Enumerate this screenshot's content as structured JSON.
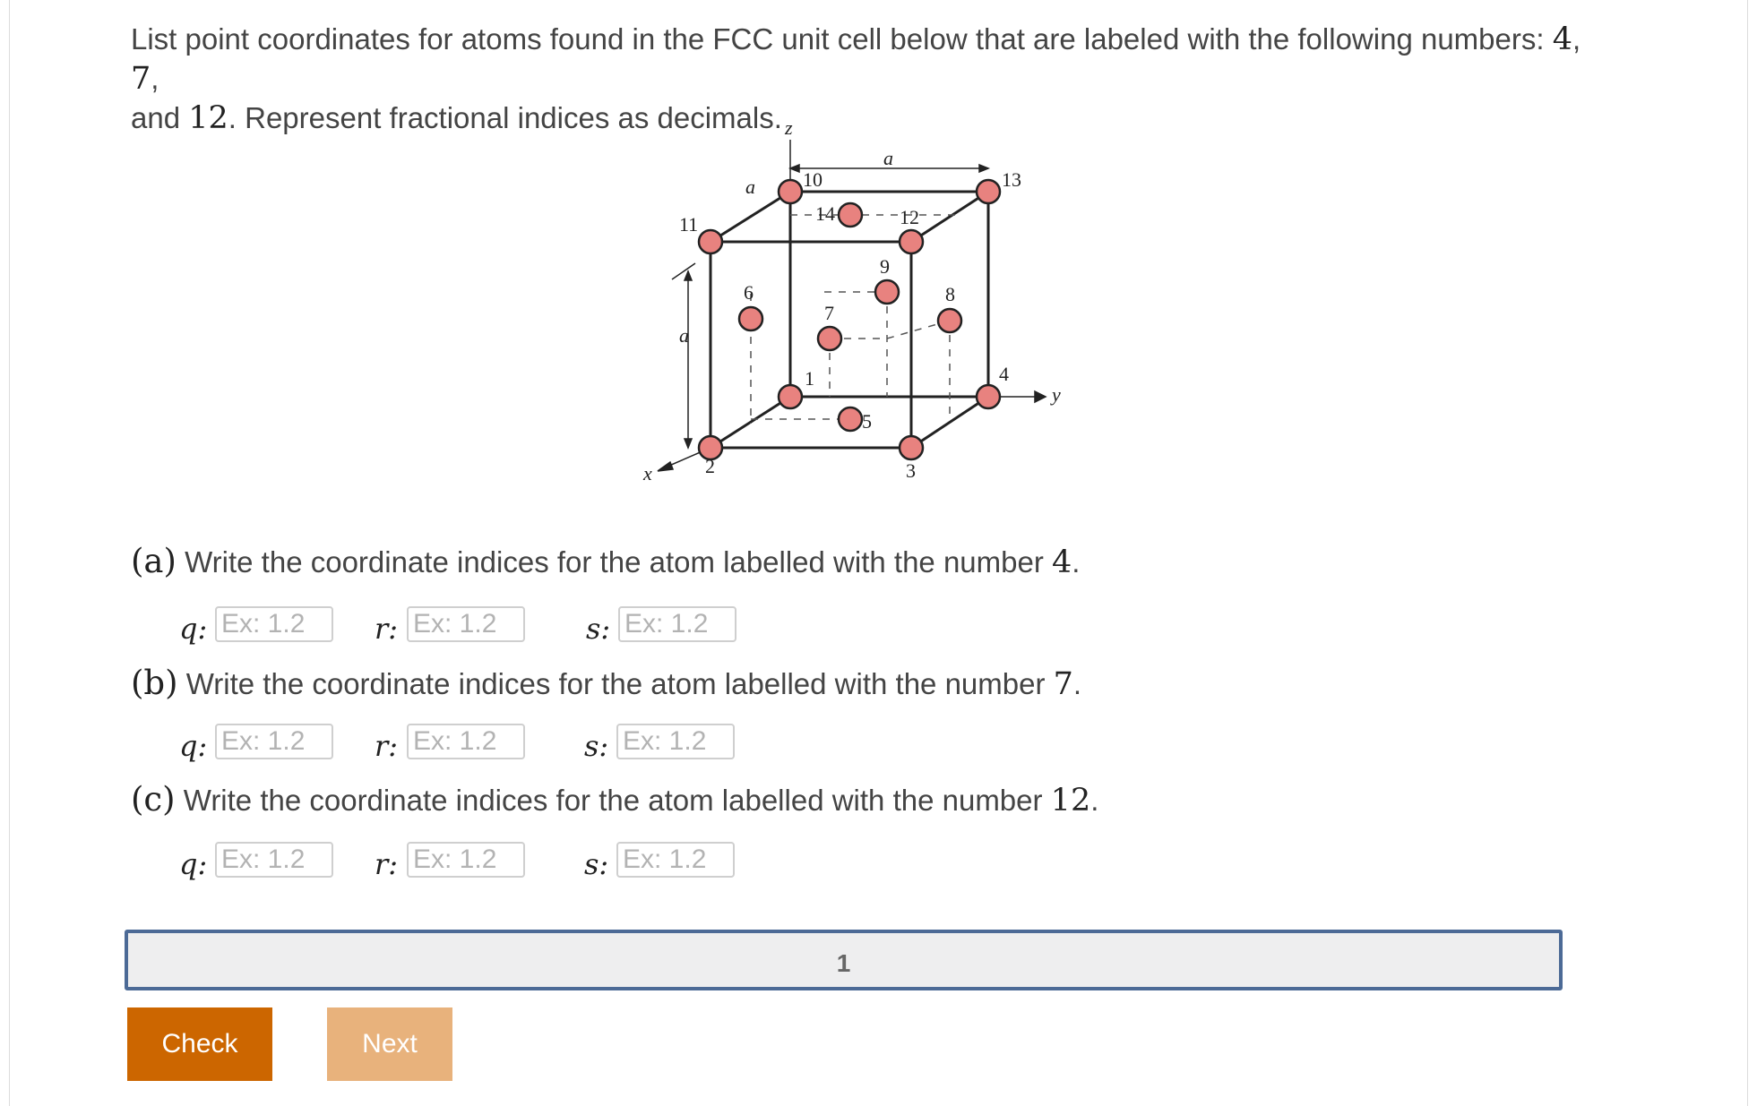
{
  "prompt": {
    "text_1": "List point coordinates for atoms found in the FCC unit cell below that are labeled with the following numbers: ",
    "n1": "4",
    "sep1": ", ",
    "n2": "7",
    "sep2": ",",
    "text_2": "and ",
    "n3": "12",
    "text_3": ". Represent fractional indices as decimals."
  },
  "figure": {
    "axes": {
      "z": "z",
      "y": "y",
      "x": "x"
    },
    "dims": {
      "top": "a",
      "left": "a",
      "vertical": "a"
    },
    "atoms": [
      "1",
      "2",
      "3",
      "4",
      "5",
      "6",
      "7",
      "8",
      "9",
      "10",
      "11",
      "12",
      "13",
      "14"
    ]
  },
  "parts": [
    {
      "tag": "(a)",
      "text": " Write the coordinate indices for the atom labelled with the number ",
      "num": "4",
      "end": ".",
      "fields": [
        {
          "label": "q:",
          "placeholder": "Ex: 1.2"
        },
        {
          "label": "r:",
          "placeholder": "Ex: 1.2"
        },
        {
          "label": "s:",
          "placeholder": "Ex: 1.2"
        }
      ]
    },
    {
      "tag": "(b)",
      "text": " Write the coordinate indices for the atom labelled with the number ",
      "num": "7",
      "end": ".",
      "fields": [
        {
          "label": "q:",
          "placeholder": "Ex: 1.2"
        },
        {
          "label": "r:",
          "placeholder": "Ex: 1.2"
        },
        {
          "label": "s:",
          "placeholder": "Ex: 1.2"
        }
      ]
    },
    {
      "tag": "(c)",
      "text": " Write the coordinate indices for the atom labelled with the number ",
      "num": "12",
      "end": ".",
      "fields": [
        {
          "label": "q:",
          "placeholder": "Ex: 1.2"
        },
        {
          "label": "r:",
          "placeholder": "Ex: 1.2"
        },
        {
          "label": "s:",
          "placeholder": "Ex: 1.2"
        }
      ]
    }
  ],
  "progress": {
    "label": "1"
  },
  "buttons": {
    "check": "Check",
    "next": "Next"
  },
  "colors": {
    "atom_fill": "#e8827f",
    "check_button": "#cc6600",
    "next_button": "#e8b27c",
    "progress_border": "#4c6a96"
  }
}
